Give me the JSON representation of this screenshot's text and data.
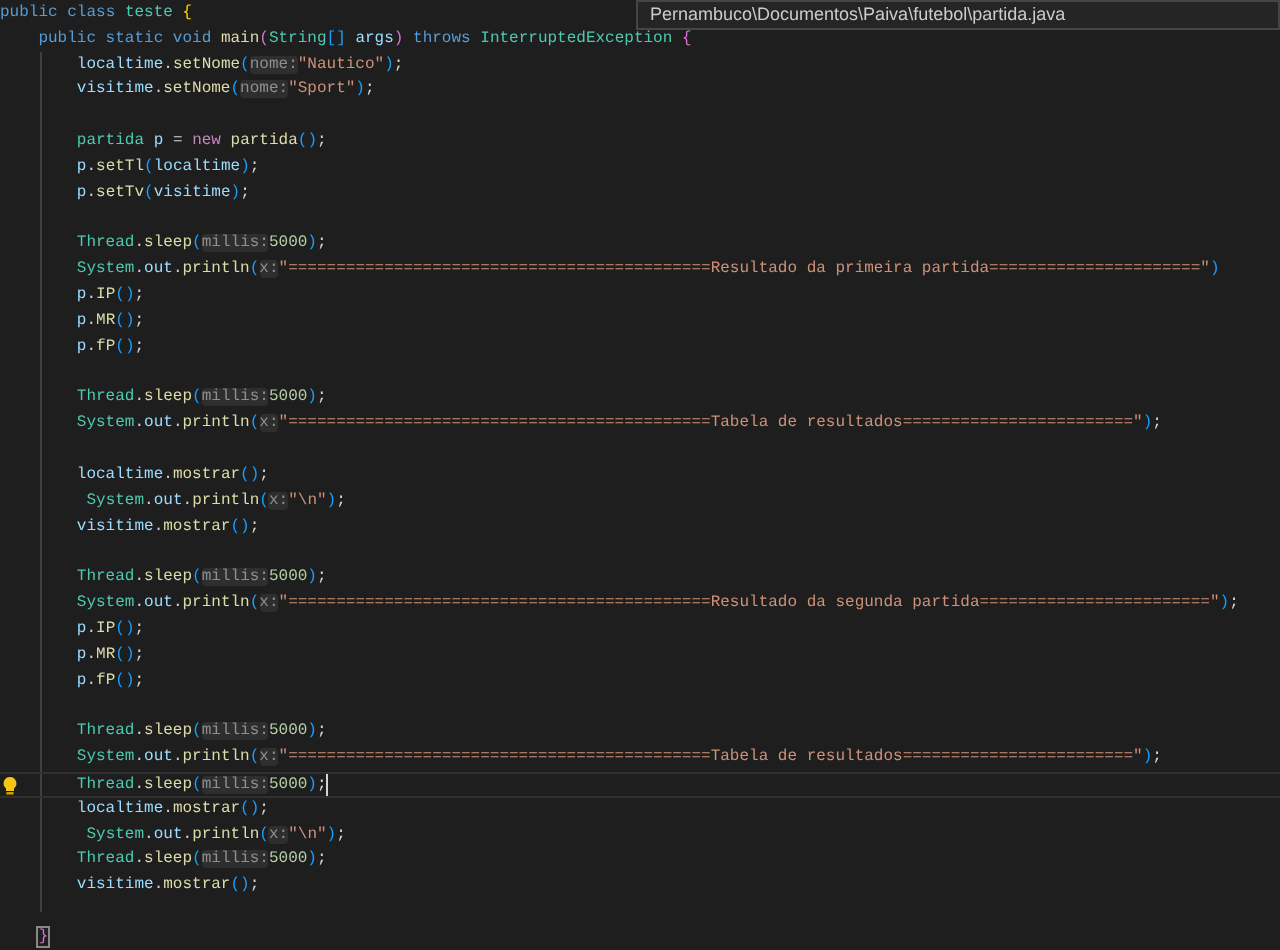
{
  "breadcrumb_tooltip": {
    "text": "Pernambuco\\Documentos\\Paiva\\futebol\\partida.java"
  },
  "lines": [
    {
      "current": false,
      "tokens": [
        {
          "text": "public",
          "kind": "kw"
        },
        {
          "text": " class",
          "kind": "kw"
        },
        {
          "text": " teste ",
          "kind": "type"
        },
        {
          "text": "{",
          "kind": "br1"
        }
      ]
    },
    {
      "current": false,
      "tokens": [
        {
          "text": "    public static void",
          "kind": "kw"
        },
        {
          "text": " main",
          "kind": "fn"
        },
        {
          "text": "(",
          "kind": "br2"
        },
        {
          "text": "String",
          "kind": "type"
        },
        {
          "text": "[]",
          "kind": "br3"
        },
        {
          "text": " args",
          "kind": "var"
        },
        {
          "text": ")",
          "kind": "br2"
        },
        {
          "text": " throws",
          "kind": "kw"
        },
        {
          "text": " InterruptedException ",
          "kind": "type"
        },
        {
          "text": "{",
          "kind": "br2"
        }
      ]
    },
    {
      "current": false,
      "tokens": [
        {
          "text": "        localtime",
          "kind": "var"
        },
        {
          "text": ".",
          "kind": "plain"
        },
        {
          "text": "setNome",
          "kind": "fn"
        },
        {
          "text": "(",
          "kind": "br3"
        },
        {
          "text": "nome:",
          "kind": "hint"
        },
        {
          "text": "\"Nautico\"",
          "kind": "str"
        },
        {
          "text": ")",
          "kind": "br3"
        },
        {
          "text": ";",
          "kind": "plain"
        }
      ]
    },
    {
      "current": false,
      "tokens": [
        {
          "text": "        visitime",
          "kind": "var"
        },
        {
          "text": ".",
          "kind": "plain"
        },
        {
          "text": "setNome",
          "kind": "fn"
        },
        {
          "text": "(",
          "kind": "br3"
        },
        {
          "text": "nome:",
          "kind": "hint"
        },
        {
          "text": "\"Sport\"",
          "kind": "str"
        },
        {
          "text": ")",
          "kind": "br3"
        },
        {
          "text": ";",
          "kind": "plain"
        }
      ]
    },
    {
      "current": false
    },
    {
      "current": false,
      "tokens": [
        {
          "text": "        partida",
          "kind": "type"
        },
        {
          "text": " p",
          "kind": "var"
        },
        {
          "text": " = ",
          "kind": "plain"
        },
        {
          "text": "new",
          "kind": "ctrl"
        },
        {
          "text": " partida",
          "kind": "fn"
        },
        {
          "text": "()",
          "kind": "br3"
        },
        {
          "text": ";",
          "kind": "plain"
        }
      ]
    },
    {
      "current": false,
      "tokens": [
        {
          "text": "        p",
          "kind": "var"
        },
        {
          "text": ".",
          "kind": "plain"
        },
        {
          "text": "setTl",
          "kind": "fn"
        },
        {
          "text": "(",
          "kind": "br3"
        },
        {
          "text": "localtime",
          "kind": "var"
        },
        {
          "text": ")",
          "kind": "br3"
        },
        {
          "text": ";",
          "kind": "plain"
        }
      ]
    },
    {
      "current": false,
      "tokens": [
        {
          "text": "        p",
          "kind": "var"
        },
        {
          "text": ".",
          "kind": "plain"
        },
        {
          "text": "setTv",
          "kind": "fn"
        },
        {
          "text": "(",
          "kind": "br3"
        },
        {
          "text": "visitime",
          "kind": "var"
        },
        {
          "text": ")",
          "kind": "br3"
        },
        {
          "text": ";",
          "kind": "plain"
        }
      ]
    },
    {
      "current": false
    },
    {
      "current": false,
      "tokens": [
        {
          "text": "        Thread",
          "kind": "type"
        },
        {
          "text": ".",
          "kind": "plain"
        },
        {
          "text": "sleep",
          "kind": "fn"
        },
        {
          "text": "(",
          "kind": "br3"
        },
        {
          "text": "millis:",
          "kind": "hint"
        },
        {
          "text": "5000",
          "kind": "num"
        },
        {
          "text": ")",
          "kind": "br3"
        },
        {
          "text": ";",
          "kind": "plain"
        }
      ]
    },
    {
      "current": false,
      "tokens": [
        {
          "text": "        System",
          "kind": "type"
        },
        {
          "text": ".",
          "kind": "plain"
        },
        {
          "text": "out",
          "kind": "var"
        },
        {
          "text": ".",
          "kind": "plain"
        },
        {
          "text": "println",
          "kind": "fn"
        },
        {
          "text": "(",
          "kind": "br3"
        },
        {
          "text": "x:",
          "kind": "hint"
        },
        {
          "text": "\"============================================Resultado da primeira partida======================\"",
          "kind": "str"
        },
        {
          "text": ")",
          "kind": "br3"
        }
      ]
    },
    {
      "current": false,
      "tokens": [
        {
          "text": "        p",
          "kind": "var"
        },
        {
          "text": ".",
          "kind": "plain"
        },
        {
          "text": "IP",
          "kind": "fn"
        },
        {
          "text": "()",
          "kind": "br3"
        },
        {
          "text": ";",
          "kind": "plain"
        }
      ]
    },
    {
      "current": false,
      "tokens": [
        {
          "text": "        p",
          "kind": "var"
        },
        {
          "text": ".",
          "kind": "plain"
        },
        {
          "text": "MR",
          "kind": "fn"
        },
        {
          "text": "()",
          "kind": "br3"
        },
        {
          "text": ";",
          "kind": "plain"
        }
      ]
    },
    {
      "current": false,
      "tokens": [
        {
          "text": "        p",
          "kind": "var"
        },
        {
          "text": ".",
          "kind": "plain"
        },
        {
          "text": "fP",
          "kind": "fn"
        },
        {
          "text": "()",
          "kind": "br3"
        },
        {
          "text": ";",
          "kind": "plain"
        }
      ]
    },
    {
      "current": false
    },
    {
      "current": false,
      "tokens": [
        {
          "text": "        Thread",
          "kind": "type"
        },
        {
          "text": ".",
          "kind": "plain"
        },
        {
          "text": "sleep",
          "kind": "fn"
        },
        {
          "text": "(",
          "kind": "br3"
        },
        {
          "text": "millis:",
          "kind": "hint"
        },
        {
          "text": "5000",
          "kind": "num"
        },
        {
          "text": ")",
          "kind": "br3"
        },
        {
          "text": ";",
          "kind": "plain"
        }
      ]
    },
    {
      "current": false,
      "tokens": [
        {
          "text": "        System",
          "kind": "type"
        },
        {
          "text": ".",
          "kind": "plain"
        },
        {
          "text": "out",
          "kind": "var"
        },
        {
          "text": ".",
          "kind": "plain"
        },
        {
          "text": "println",
          "kind": "fn"
        },
        {
          "text": "(",
          "kind": "br3"
        },
        {
          "text": "x:",
          "kind": "hint"
        },
        {
          "text": "\"============================================Tabela de resultados========================\"",
          "kind": "str"
        },
        {
          "text": ")",
          "kind": "br3"
        },
        {
          "text": ";",
          "kind": "plain"
        }
      ]
    },
    {
      "current": false
    },
    {
      "current": false,
      "tokens": [
        {
          "text": "        localtime",
          "kind": "var"
        },
        {
          "text": ".",
          "kind": "plain"
        },
        {
          "text": "mostrar",
          "kind": "fn"
        },
        {
          "text": "()",
          "kind": "br3"
        },
        {
          "text": ";",
          "kind": "plain"
        }
      ]
    },
    {
      "current": false,
      "tokens": [
        {
          "text": "         System",
          "kind": "type"
        },
        {
          "text": ".",
          "kind": "plain"
        },
        {
          "text": "out",
          "kind": "var"
        },
        {
          "text": ".",
          "kind": "plain"
        },
        {
          "text": "println",
          "kind": "fn"
        },
        {
          "text": "(",
          "kind": "br3"
        },
        {
          "text": "x:",
          "kind": "hint"
        },
        {
          "text": "\"\\n\"",
          "kind": "str"
        },
        {
          "text": ")",
          "kind": "br3"
        },
        {
          "text": ";",
          "kind": "plain"
        }
      ]
    },
    {
      "current": false,
      "tokens": [
        {
          "text": "        visitime",
          "kind": "var"
        },
        {
          "text": ".",
          "kind": "plain"
        },
        {
          "text": "mostrar",
          "kind": "fn"
        },
        {
          "text": "()",
          "kind": "br3"
        },
        {
          "text": ";",
          "kind": "plain"
        }
      ]
    },
    {
      "current": false
    },
    {
      "current": false,
      "tokens": [
        {
          "text": "        Thread",
          "kind": "type"
        },
        {
          "text": ".",
          "kind": "plain"
        },
        {
          "text": "sleep",
          "kind": "fn"
        },
        {
          "text": "(",
          "kind": "br3"
        },
        {
          "text": "millis:",
          "kind": "hint"
        },
        {
          "text": "5000",
          "kind": "num"
        },
        {
          "text": ")",
          "kind": "br3"
        },
        {
          "text": ";",
          "kind": "plain"
        }
      ]
    },
    {
      "current": false,
      "tokens": [
        {
          "text": "        System",
          "kind": "type"
        },
        {
          "text": ".",
          "kind": "plain"
        },
        {
          "text": "out",
          "kind": "var"
        },
        {
          "text": ".",
          "kind": "plain"
        },
        {
          "text": "println",
          "kind": "fn"
        },
        {
          "text": "(",
          "kind": "br3"
        },
        {
          "text": "x:",
          "kind": "hint"
        },
        {
          "text": "\"============================================Resultado da segunda partida========================\"",
          "kind": "str"
        },
        {
          "text": ")",
          "kind": "br3"
        },
        {
          "text": ";",
          "kind": "plain"
        }
      ]
    },
    {
      "current": false,
      "tokens": [
        {
          "text": "        p",
          "kind": "var"
        },
        {
          "text": ".",
          "kind": "plain"
        },
        {
          "text": "IP",
          "kind": "fn"
        },
        {
          "text": "()",
          "kind": "br3"
        },
        {
          "text": ";",
          "kind": "plain"
        }
      ]
    },
    {
      "current": false,
      "tokens": [
        {
          "text": "        p",
          "kind": "var"
        },
        {
          "text": ".",
          "kind": "plain"
        },
        {
          "text": "MR",
          "kind": "fn"
        },
        {
          "text": "()",
          "kind": "br3"
        },
        {
          "text": ";",
          "kind": "plain"
        }
      ]
    },
    {
      "current": false,
      "tokens": [
        {
          "text": "        p",
          "kind": "var"
        },
        {
          "text": ".",
          "kind": "plain"
        },
        {
          "text": "fP",
          "kind": "fn"
        },
        {
          "text": "()",
          "kind": "br3"
        },
        {
          "text": ";",
          "kind": "plain"
        }
      ]
    },
    {
      "current": false
    },
    {
      "current": false,
      "tokens": [
        {
          "text": "        Thread",
          "kind": "type"
        },
        {
          "text": ".",
          "kind": "plain"
        },
        {
          "text": "sleep",
          "kind": "fn"
        },
        {
          "text": "(",
          "kind": "br3"
        },
        {
          "text": "millis:",
          "kind": "hint"
        },
        {
          "text": "5000",
          "kind": "num"
        },
        {
          "text": ")",
          "kind": "br3"
        },
        {
          "text": ";",
          "kind": "plain"
        }
      ]
    },
    {
      "current": false,
      "tokens": [
        {
          "text": "        System",
          "kind": "type"
        },
        {
          "text": ".",
          "kind": "plain"
        },
        {
          "text": "out",
          "kind": "var"
        },
        {
          "text": ".",
          "kind": "plain"
        },
        {
          "text": "println",
          "kind": "fn"
        },
        {
          "text": "(",
          "kind": "br3"
        },
        {
          "text": "x:",
          "kind": "hint"
        },
        {
          "text": "\"============================================Tabela de resultados========================\"",
          "kind": "str"
        },
        {
          "text": ")",
          "kind": "br3"
        },
        {
          "text": ";",
          "kind": "plain"
        }
      ]
    },
    {
      "current": true,
      "tokens": [
        {
          "text": "        Thread",
          "kind": "type"
        },
        {
          "text": ".",
          "kind": "plain"
        },
        {
          "text": "sleep",
          "kind": "fn"
        },
        {
          "text": "(",
          "kind": "br3"
        },
        {
          "text": "millis:",
          "kind": "hint"
        },
        {
          "text": "5000",
          "kind": "num"
        },
        {
          "text": ")",
          "kind": "br3"
        },
        {
          "text": ";",
          "kind": "plain"
        }
      ]
    },
    {
      "current": false,
      "tokens": [
        {
          "text": "        localtime",
          "kind": "var"
        },
        {
          "text": ".",
          "kind": "plain"
        },
        {
          "text": "mostrar",
          "kind": "fn"
        },
        {
          "text": "()",
          "kind": "br3"
        },
        {
          "text": ";",
          "kind": "plain"
        }
      ]
    },
    {
      "current": false,
      "tokens": [
        {
          "text": "         System",
          "kind": "type"
        },
        {
          "text": ".",
          "kind": "plain"
        },
        {
          "text": "out",
          "kind": "var"
        },
        {
          "text": ".",
          "kind": "plain"
        },
        {
          "text": "println",
          "kind": "fn"
        },
        {
          "text": "(",
          "kind": "br3"
        },
        {
          "text": "x:",
          "kind": "hint"
        },
        {
          "text": "\"\\n\"",
          "kind": "str"
        },
        {
          "text": ")",
          "kind": "br3"
        },
        {
          "text": ";",
          "kind": "plain"
        }
      ]
    },
    {
      "current": false,
      "tokens": [
        {
          "text": "        Thread",
          "kind": "type"
        },
        {
          "text": ".",
          "kind": "plain"
        },
        {
          "text": "sleep",
          "kind": "fn"
        },
        {
          "text": "(",
          "kind": "br3"
        },
        {
          "text": "millis:",
          "kind": "hint"
        },
        {
          "text": "5000",
          "kind": "num"
        },
        {
          "text": ")",
          "kind": "br3"
        },
        {
          "text": ";",
          "kind": "plain"
        }
      ]
    },
    {
      "current": false,
      "tokens": [
        {
          "text": "        visitime",
          "kind": "var"
        },
        {
          "text": ".",
          "kind": "plain"
        },
        {
          "text": "mostrar",
          "kind": "fn"
        },
        {
          "text": "()",
          "kind": "br3"
        },
        {
          "text": ";",
          "kind": "plain"
        }
      ]
    },
    {
      "current": false
    },
    {
      "current": false,
      "tokens": [
        {
          "text": "    }",
          "kind": "match"
        }
      ]
    }
  ]
}
